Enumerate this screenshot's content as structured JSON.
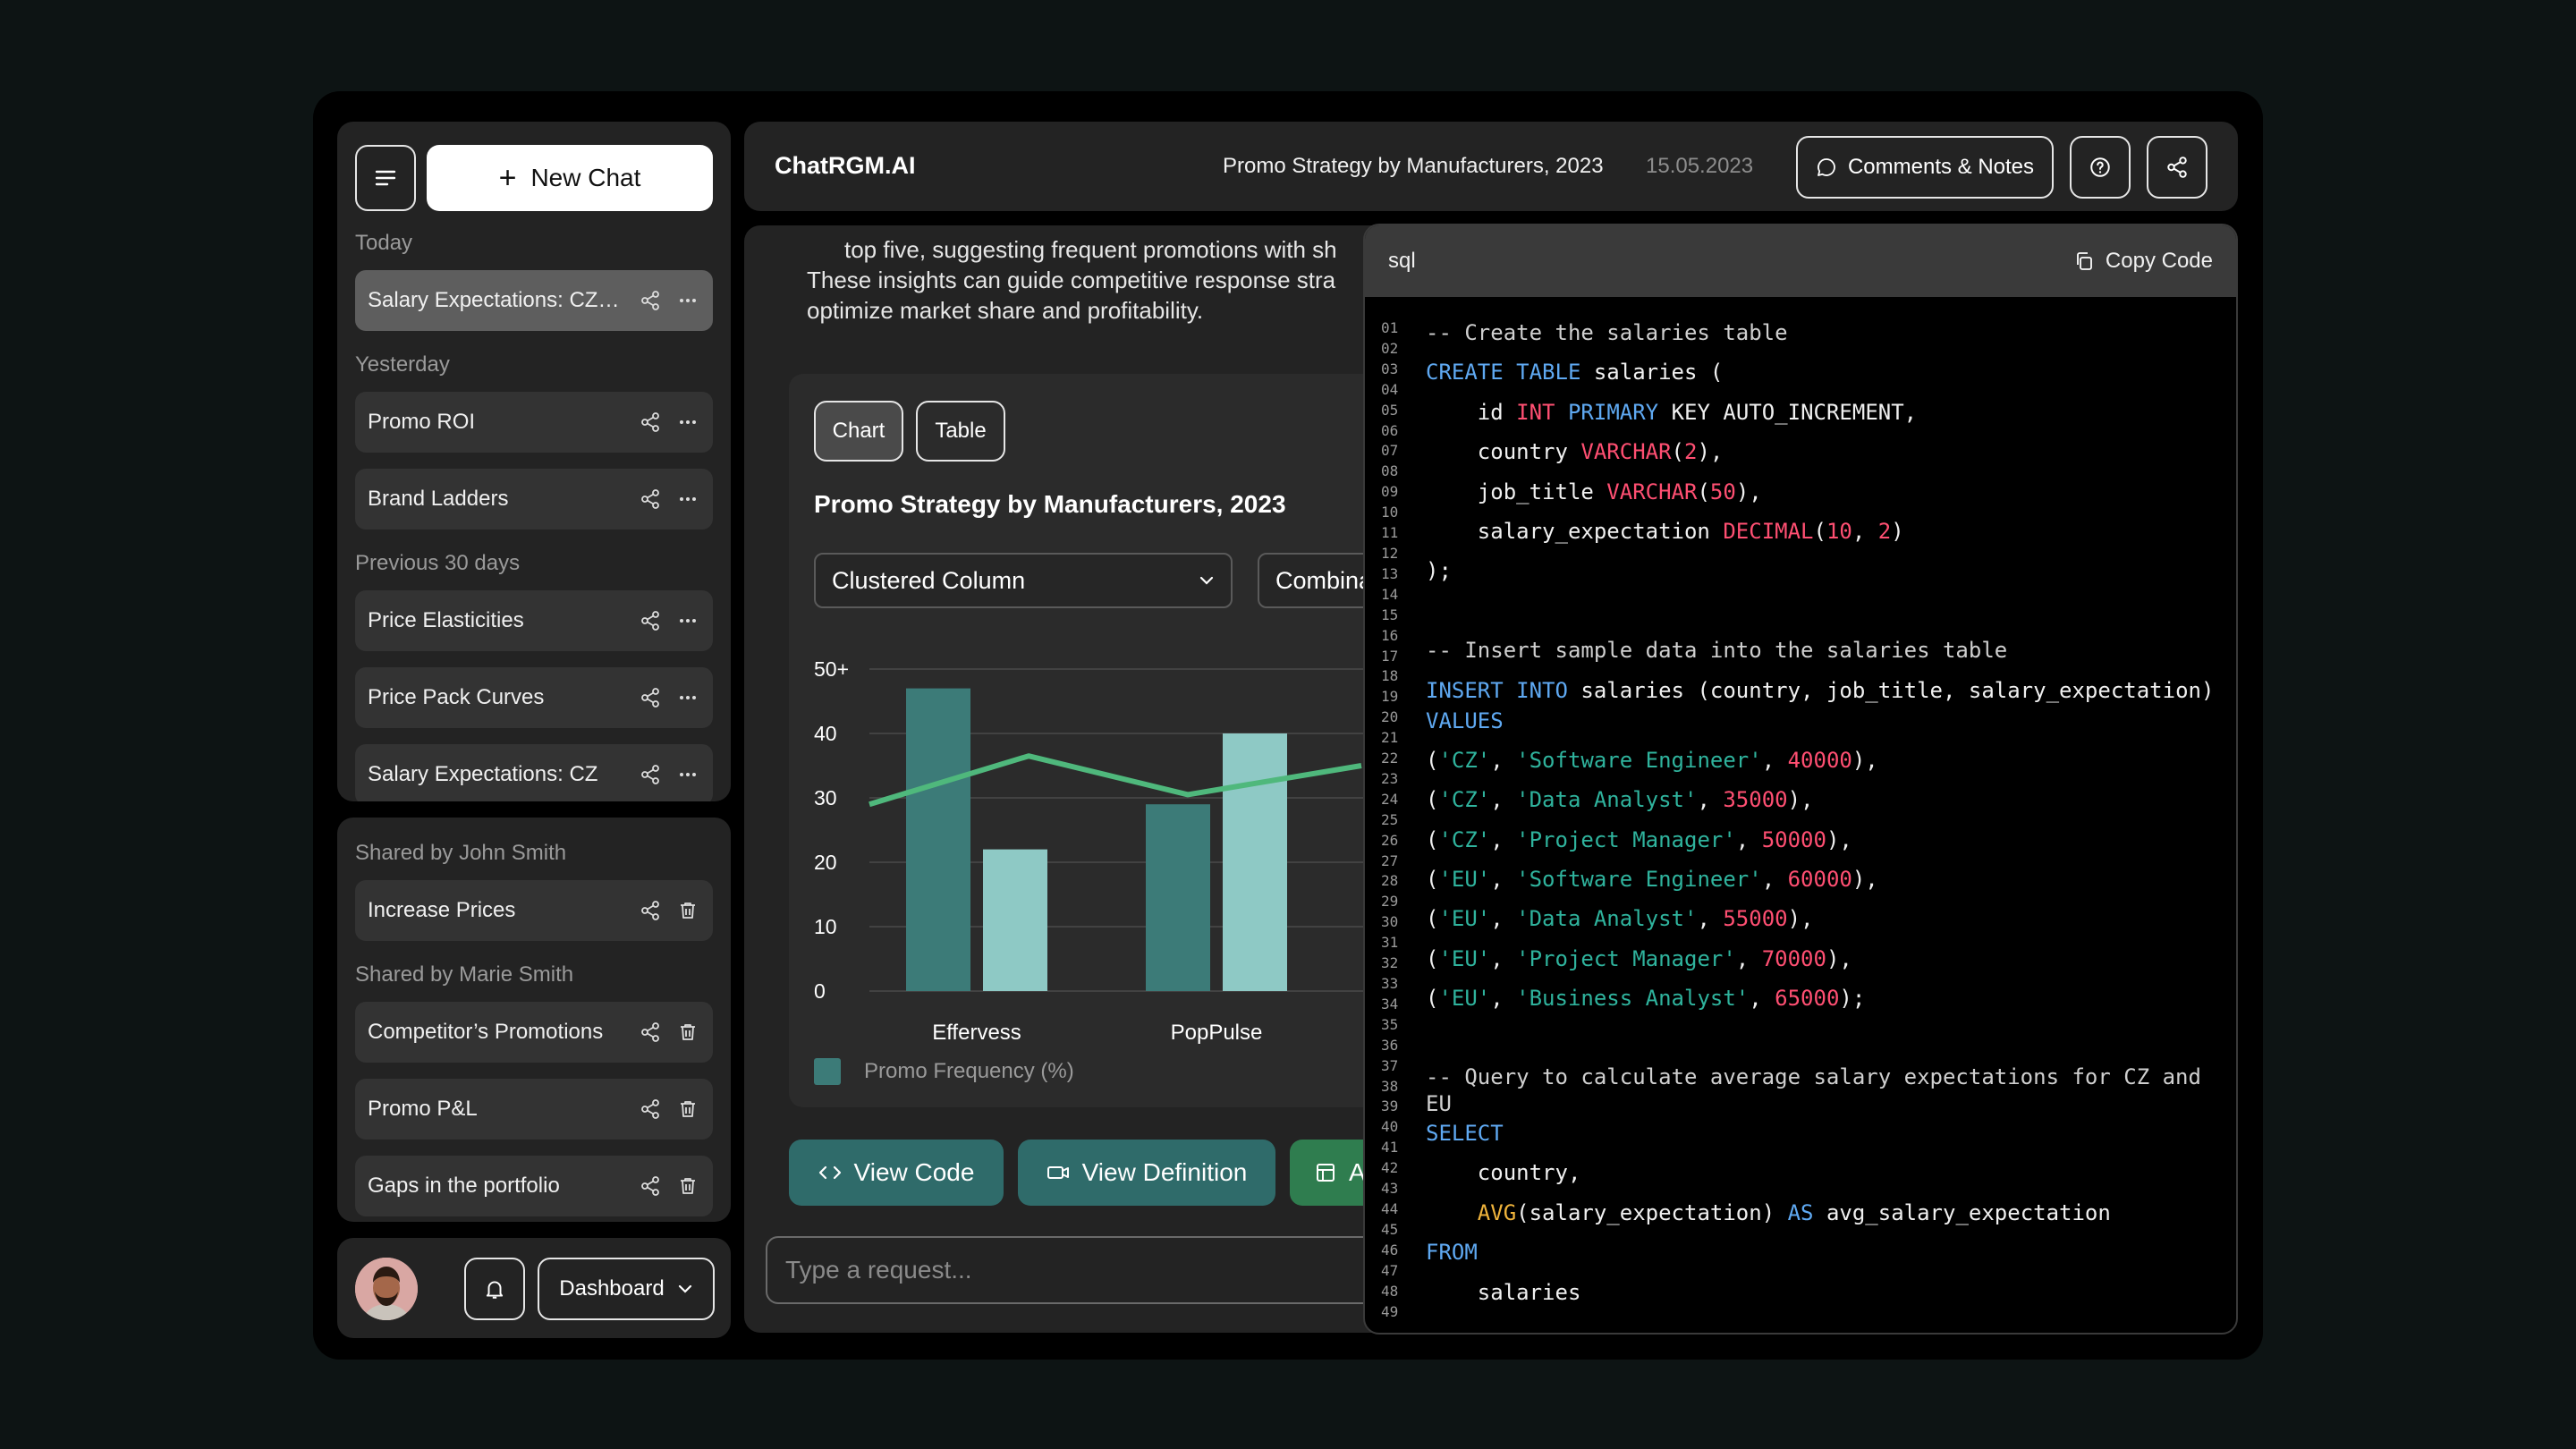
{
  "sidebar": {
    "new_chat_label": "New Chat",
    "groups": [
      {
        "label": "Today",
        "items": [
          {
            "label": "Salary Expectations: CZ and EU"
          }
        ]
      },
      {
        "label": "Yesterday",
        "items": [
          {
            "label": "Promo ROI"
          },
          {
            "label": "Brand Ladders"
          }
        ]
      },
      {
        "label": "Previous 30 days",
        "items": [
          {
            "label": "Price Elasticities"
          },
          {
            "label": "Price Pack Curves"
          },
          {
            "label": "Salary Expectations: CZ"
          }
        ]
      }
    ],
    "shared": [
      {
        "label": "Shared by John Smith",
        "items": [
          {
            "label": "Increase Prices"
          }
        ]
      },
      {
        "label": "Shared by Marie Smith",
        "items": [
          {
            "label": "Competitor’s Promotions"
          },
          {
            "label": "Promo P&L"
          },
          {
            "label": "Gaps in the portfolio"
          }
        ]
      }
    ],
    "dashboard_label": "Dashboard"
  },
  "header": {
    "brand": "ChatRGM.AI",
    "title": "Promo Strategy by Manufacturers, 2023",
    "date": "15.05.2023",
    "comments_label": "Comments & Notes"
  },
  "main": {
    "text_lines": [
      "top five, suggesting frequent promotions with sh",
      "These insights can guide competitive response stra",
      "optimize market share and profitability."
    ],
    "tabs": [
      "Chart",
      "Table"
    ],
    "chart_title": "Promo Strategy by Manufacturers, 2023",
    "chart_type_select": "Clustered Column",
    "combination_select": "Combina",
    "buttons": {
      "view_code": "View Code",
      "view_definition": "View Definition",
      "third": "A"
    },
    "input_placeholder": "Type a request..."
  },
  "chart_data": {
    "type": "bar",
    "categories": [
      "Effervess",
      "PopPulse"
    ],
    "series": [
      {
        "name": "Promo Frequency (%)",
        "values": [
          47,
          29
        ],
        "color": "#3c7b78"
      },
      {
        "values": [
          22,
          40
        ],
        "color": "#8ec9c5"
      }
    ],
    "line": {
      "values": [
        29,
        36.5,
        30.5,
        35
      ],
      "color": "#4fb87c"
    },
    "ytick_labels": [
      "0",
      "10",
      "20",
      "30",
      "40",
      "50+"
    ],
    "ylim": [
      0,
      50
    ],
    "grid": true,
    "legend": "bottom-left"
  },
  "code_panel": {
    "language": "sql",
    "copy_label": "Copy Code",
    "line_numbers": [
      "01",
      "02",
      "03",
      "04",
      "05",
      "06",
      "07",
      "08",
      "09",
      "10",
      "11",
      "12",
      "13",
      "14",
      "15",
      "16",
      "17",
      "18",
      "19",
      "20",
      "21",
      "22",
      "23",
      "24",
      "25",
      "26",
      "27",
      "28",
      "29",
      "30",
      "31",
      "32",
      "33",
      "34",
      "35",
      "36",
      "37",
      "38",
      "39",
      "40",
      "41",
      "42",
      "43",
      "44",
      "45",
      "46",
      "47",
      "48",
      "49"
    ]
  },
  "colors": {
    "accent_teal": "#3c7b78",
    "light_teal": "#8ec9c5",
    "line_green": "#4fb87c",
    "button_teal": "#2f6b6a",
    "button_green": "#2f7d4f"
  }
}
